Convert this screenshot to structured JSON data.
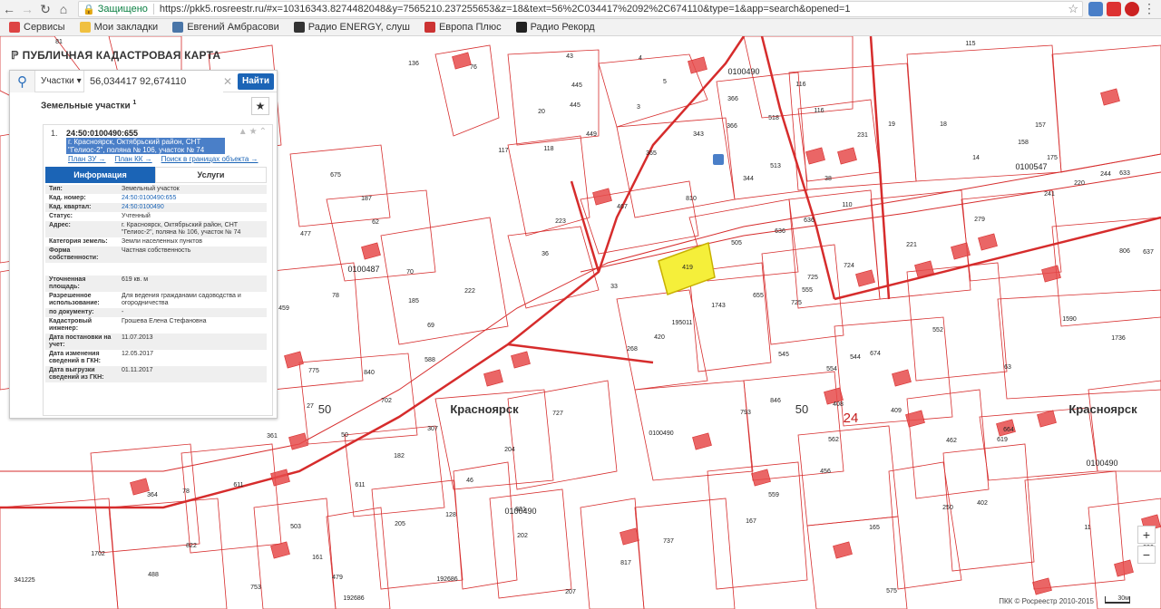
{
  "browser": {
    "secure_label": "Защищено",
    "url": "https://pkk5.rosreestr.ru/#x=10316343.8274482048&y=7565210.237255653&z=18&text=56%2C034417%2092%2C674110&type=1&app=search&opened=1",
    "bookmarks": [
      {
        "label": "Сервисы",
        "icon": "apps-icon",
        "color": "#d44"
      },
      {
        "label": "Мои закладки",
        "icon": "folder-icon",
        "color": "#f0c040"
      },
      {
        "label": "Евгений Амбрасови",
        "icon": "vk-icon",
        "color": "#4a76a8"
      },
      {
        "label": "Радио ENERGY, слуш",
        "icon": "play-icon",
        "color": "#333"
      },
      {
        "label": "Европа Плюс",
        "icon": "radio-icon",
        "color": "#c33"
      },
      {
        "label": "Радио Рекорд",
        "icon": "record-icon",
        "color": "#222"
      }
    ]
  },
  "portal": {
    "title": "ПУБЛИЧНАЯ КАДАСТРОВАЯ КАРТА"
  },
  "search": {
    "type": "Участки",
    "query": "56,034417 92,674110",
    "button": "Найти"
  },
  "results": {
    "heading": "Земельные участки",
    "count": "1"
  },
  "card": {
    "num": "1.",
    "code": "24:50:0100490:655",
    "addr": "г. Красноярск, Октябрьский район, СНТ \"Гелиос-2\", поляна № 106, участок № 74",
    "links": [
      "План ЗУ →",
      "План КК →",
      "Поиск в границах объекта →"
    ],
    "tabs": [
      "Информация",
      "Услуги"
    ],
    "info": [
      {
        "k": "Тип:",
        "v": "Земельный участок"
      },
      {
        "k": "Кад. номер:",
        "v": "24:50:0100490:655",
        "link": true
      },
      {
        "k": "Кад. квартал:",
        "v": "24:50:0100490",
        "link": true
      },
      {
        "k": "Статус:",
        "v": "Учтенный"
      },
      {
        "k": "Адрес:",
        "v": "г. Красноярск, Октябрьский район, СНТ \"Гелиос-2\", поляна № 106, участок № 74"
      },
      {
        "k": "Категория земель:",
        "v": "Земли населенных пунктов"
      },
      {
        "k": "Форма собственности:",
        "v": "Частная собственность"
      },
      {
        "k": "",
        "v": ""
      },
      {
        "k": "Уточненная площадь:",
        "v": "619 кв. м"
      },
      {
        "k": "Разрешенное использование:",
        "v": "Для ведения гражданами садоводства и огородничества"
      },
      {
        "k": "по документу:",
        "v": "-"
      },
      {
        "k": "Кадастровый инженер:",
        "v": "Грошева Елена Стефановна"
      },
      {
        "k": "Дата постановки на учет:",
        "v": "11.07.2013"
      },
      {
        "k": "Дата изменения сведений в ГКН:",
        "v": "12.05.2017"
      },
      {
        "k": "Дата выгрузки сведений из ГКН:",
        "v": "01.11.2017"
      }
    ]
  },
  "map": {
    "city_labels": [
      "Красноярск",
      "Красноярск"
    ],
    "district_labels": [
      "50",
      "50",
      "24"
    ],
    "quarter_labels": [
      "0100490",
      "0100547",
      "0100487",
      "0100490",
      "0100490"
    ],
    "parcel_labels": [
      "81",
      "136",
      "76",
      "43",
      "445",
      "445",
      "4",
      "5",
      "115",
      "116",
      "116",
      "20",
      "117",
      "118",
      "449",
      "3",
      "343",
      "366",
      "366",
      "518",
      "513",
      "344",
      "38",
      "231",
      "19",
      "18",
      "157",
      "158",
      "14",
      "175",
      "224",
      "187",
      "477",
      "62",
      "70",
      "185",
      "222",
      "78",
      "459",
      "69",
      "588",
      "675",
      "223",
      "36",
      "467",
      "365",
      "810",
      "505",
      "636",
      "636",
      "110",
      "221",
      "279",
      "244",
      "220",
      "633",
      "637",
      "806",
      "241",
      "33",
      "419",
      "655",
      "555",
      "725",
      "725",
      "724",
      "195011",
      "1743",
      "268",
      "420",
      "545",
      "554",
      "544",
      "674",
      "552",
      "1590",
      "1736",
      "63",
      "775",
      "840",
      "702",
      "27",
      "361",
      "50",
      "307",
      "182",
      "204",
      "727",
      "364",
      "78",
      "611",
      "611",
      "46",
      "205",
      "128",
      "821",
      "202",
      "0100490",
      "793",
      "846",
      "408",
      "409",
      "462",
      "619",
      "664",
      "456",
      "562",
      "559",
      "167",
      "250",
      "402",
      "165",
      "503",
      "161",
      "479",
      "753",
      "1702",
      "822",
      "488",
      "341225",
      "192686",
      "192686",
      "207",
      "817",
      "737",
      "11",
      "230",
      "575",
      "876",
      "875",
      "615",
      "100",
      "160"
    ],
    "scale_label": "30м",
    "attribution": "ПКК © Росреестр 2010-2015",
    "colors": {
      "boundary": "#d62c2c",
      "selected_fill": "#f5ef3a",
      "building": "#e64b4b"
    }
  }
}
